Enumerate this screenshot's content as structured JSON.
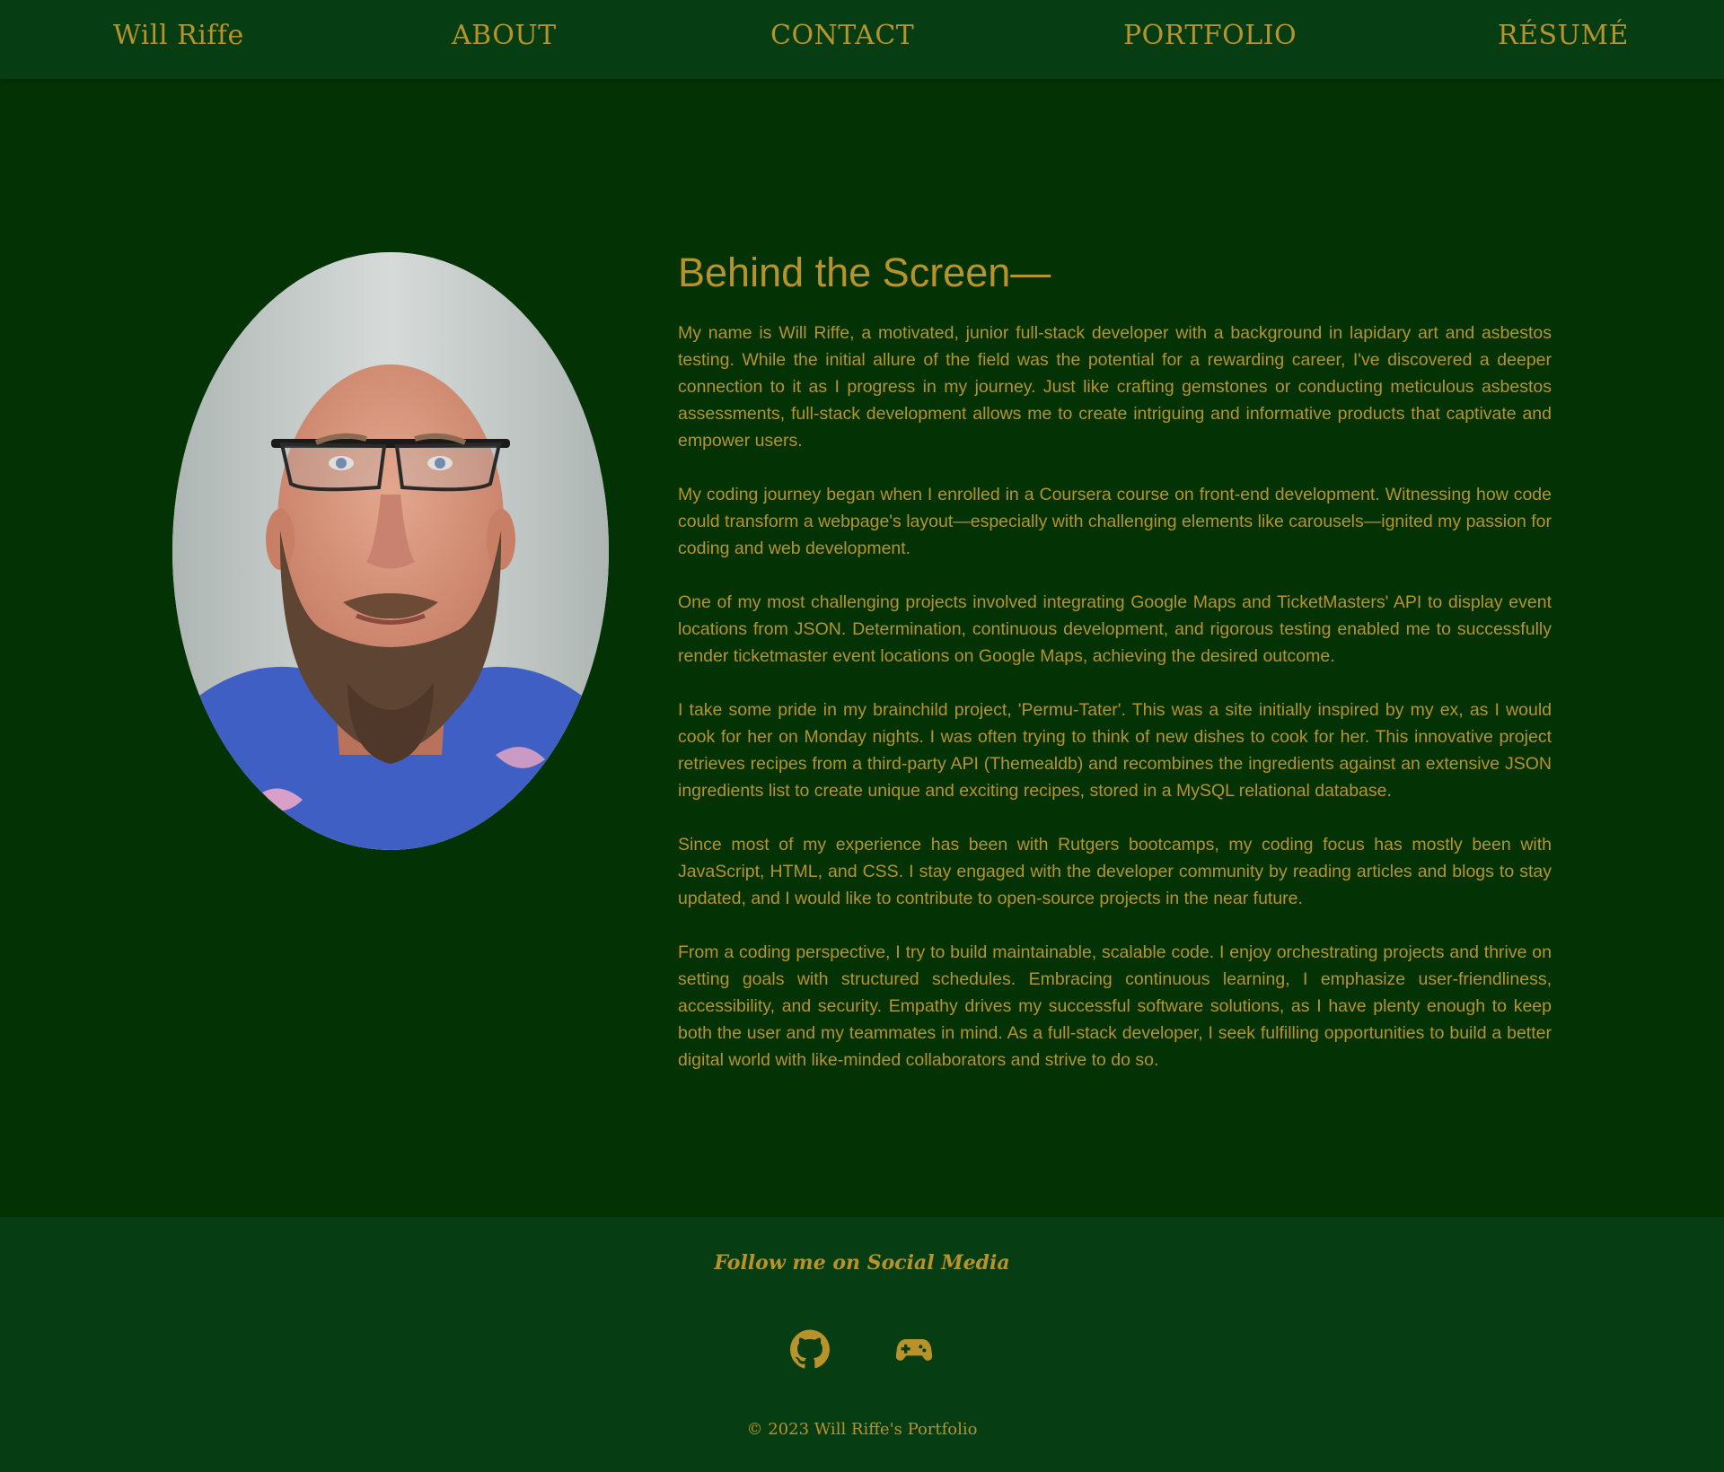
{
  "nav": {
    "brand": "Will Riffe",
    "about": "ABOUT",
    "contact": "CONTACT",
    "portfolio": "PORTFOLIO",
    "resume": "RÉSUMÉ"
  },
  "bio": {
    "heading": "Behind the Screen—",
    "paragraphs": [
      "My name is Will Riffe, a motivated, junior full-stack developer with a background in lapidary art and asbestos testing. While the initial allure of the field was the potential for a rewarding career, I've discovered a deeper connection to it as I progress in my journey. Just like crafting gemstones or conducting meticulous asbestos assessments, full-stack development allows me to create intriguing and informative products that captivate and empower users.",
      "My coding journey began when I enrolled in a Coursera course on front-end development. Witnessing how code could transform a webpage's layout—especially with challenging elements like carousels—ignited my passion for coding and web development.",
      "One of my most challenging projects involved integrating Google Maps and TicketMasters' API to display event locations from JSON. Determination, continuous development, and rigorous testing enabled me to successfully render ticketmaster event locations on Google Maps, achieving the desired outcome.",
      "I take some pride in my brainchild project, 'Permu-Tater'. This was a site initially inspired by my ex, as I would cook for her on Monday nights. I was often trying to think of new dishes to cook for her. This innovative project retrieves recipes from a third-party API (Themealdb) and recombines the ingredients against an extensive JSON ingredients list to create unique and exciting recipes, stored in a MySQL relational database.",
      "Since most of my experience has been with Rutgers bootcamps, my coding focus has mostly been with JavaScript, HTML, and CSS. I stay engaged with the developer community by reading articles and blogs to stay updated, and I would like to contribute to open-source projects in the near future.",
      "From a coding perspective, I try to build maintainable, scalable code. I enjoy orchestrating projects and thrive on setting goals with structured schedules. Embracing continuous learning, I emphasize user-friendliness, accessibility, and security. Empathy drives my successful software solutions, as I have plenty enough to keep both the user and my teammates in mind. As a full-stack developer, I seek fulfilling opportunities to build a better digital world with like-minded collaborators and strive to do so."
    ]
  },
  "footer": {
    "title": "Follow me on Social Media",
    "social": [
      {
        "icon": "github-icon"
      },
      {
        "icon": "gamepad-icon"
      }
    ],
    "copyright": "© 2023 Will Riffe's Portfolio"
  },
  "colors": {
    "page_background": "#033305",
    "bar_background": "#063d13",
    "accent_text": "#b8922a"
  }
}
